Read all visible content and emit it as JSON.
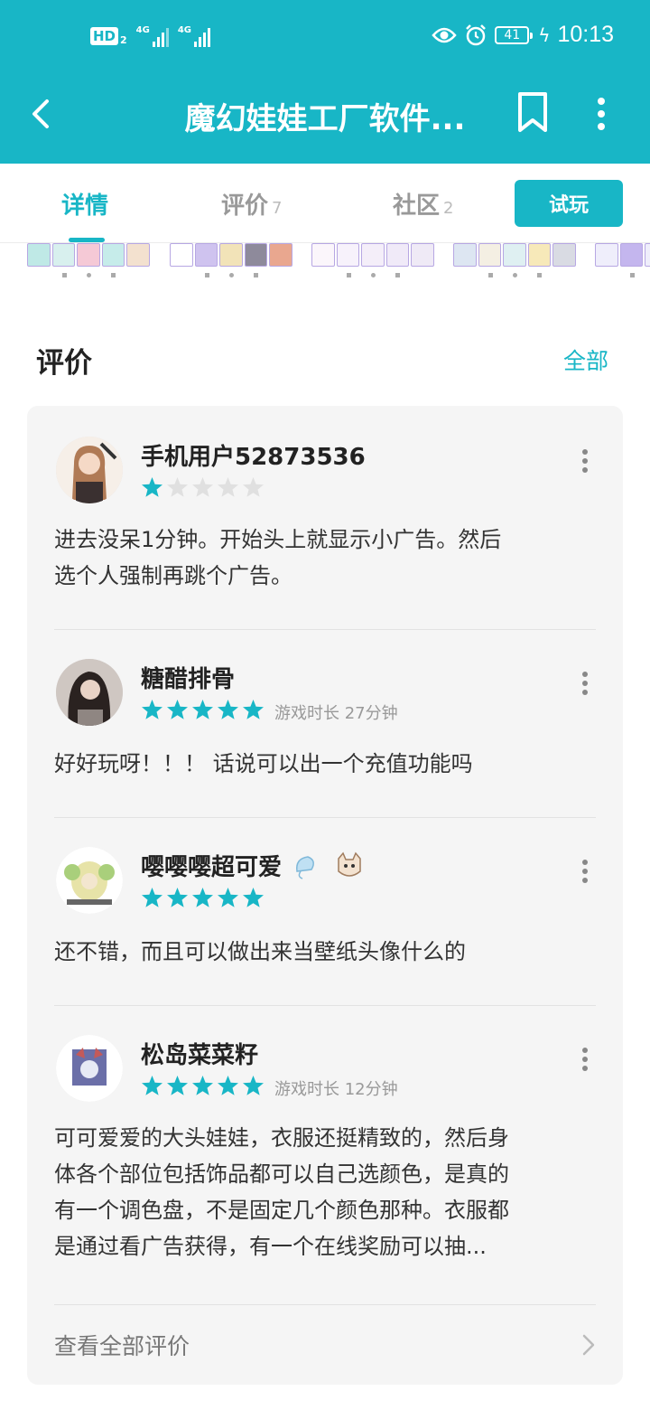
{
  "status_bar": {
    "hd": "HD",
    "hd_sub": "2",
    "sim1": "4G",
    "sim2": "4G",
    "battery": "41",
    "time": "10:13"
  },
  "header": {
    "title": "魔幻娃娃工厂软件..."
  },
  "tabs": [
    {
      "label": "详情",
      "count": ""
    },
    {
      "label": "评价",
      "count": "7"
    },
    {
      "label": "社区",
      "count": "2"
    }
  ],
  "try_button": "试玩",
  "reviews_section": {
    "title": "评价",
    "all_link": "全部"
  },
  "reviews": [
    {
      "user": "手机用户52873536",
      "rating": 1,
      "playtime": "",
      "text_lines": [
        "进去没呆1分钟。开始头上就显示小广告。然后",
        "选个人强制再跳个广告。"
      ]
    },
    {
      "user": "糖醋排骨",
      "rating": 5,
      "playtime": "游戏时长 27分钟",
      "text_lines": [
        "好好玩呀！！！ 话说可以出一个充值功能吗"
      ]
    },
    {
      "user": "嘤嘤嘤超可爱",
      "rating": 5,
      "playtime": "",
      "text_lines": [
        "还不错，而且可以做出来当壁纸头像什么的"
      ]
    },
    {
      "user": "松岛菜菜籽",
      "rating": 5,
      "playtime": "游戏时长 12分钟",
      "text_lines": [
        "可可爱爱的大头娃娃，衣服还挺精致的，然后身",
        "体各个部位包括饰品都可以自己选颜色，是真的",
        "有一个调色盘，不是固定几个颜色那种。衣服都",
        "是通过看广告获得，有一个在线奖励可以抽..."
      ]
    }
  ],
  "footer_link": "查看全部评价",
  "colors": {
    "accent": "#18b6c6",
    "star_off": "#e0e0e0",
    "card_bg": "#f5f5f5"
  }
}
